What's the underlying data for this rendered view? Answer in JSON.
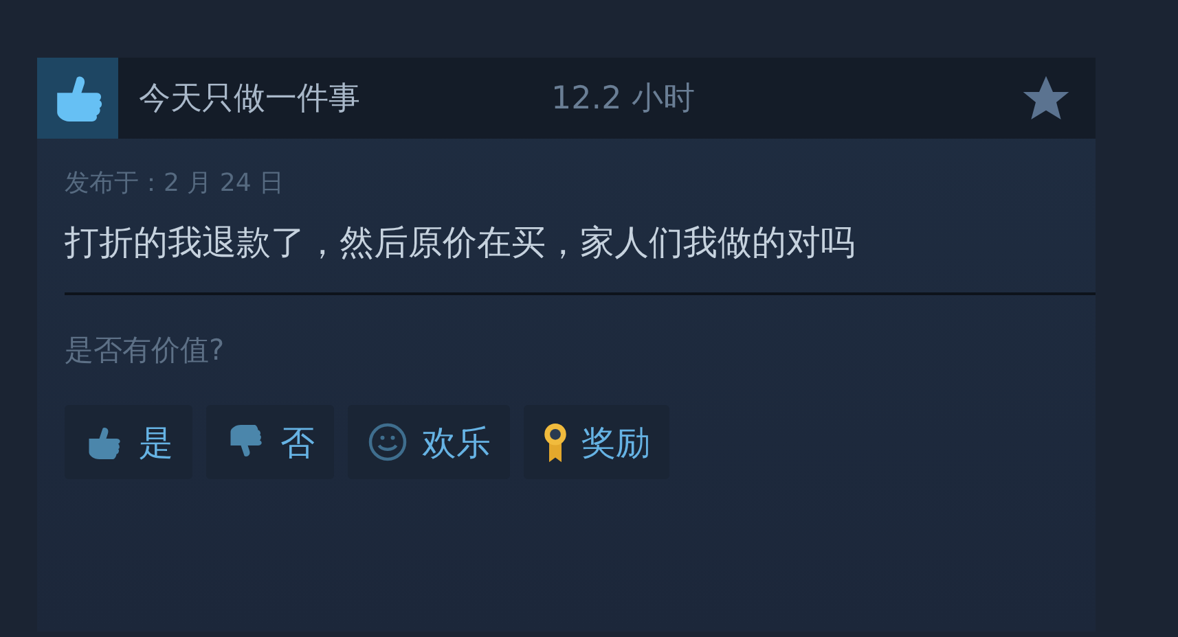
{
  "review": {
    "recommended": true,
    "title": "今天只做一件事",
    "hours": "12.2 小时",
    "posted": "发布于：2 月 24 日",
    "text": "打折的我退款了，然后原价在买，家人们我做的对吗"
  },
  "helpful": {
    "question": "是否有价值?",
    "buttons": [
      {
        "kind": "up",
        "label": "是"
      },
      {
        "kind": "down",
        "label": "否"
      },
      {
        "kind": "smile",
        "label": "欢乐"
      },
      {
        "kind": "award",
        "label": "奖励"
      }
    ]
  }
}
